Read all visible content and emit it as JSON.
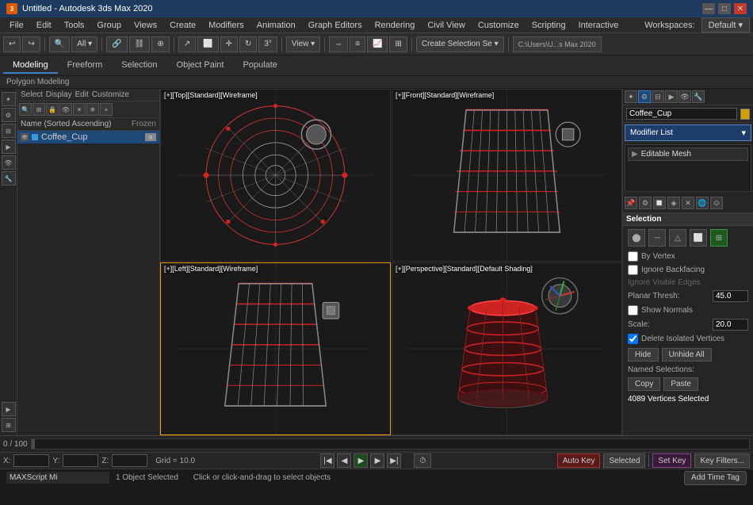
{
  "titlebar": {
    "title": "Untitled - Autodesk 3ds Max 2020",
    "icon": "3",
    "minimize": "—",
    "maximize": "□",
    "close": "✕"
  },
  "menubar": {
    "items": [
      "File",
      "Edit",
      "Tools",
      "Group",
      "Views",
      "Create",
      "Modifiers",
      "Animation",
      "Graph Editors",
      "Rendering",
      "Civil View",
      "Customize",
      "Scripting",
      "Interactive"
    ]
  },
  "toolbar": {
    "undo": "↩",
    "redo": "↪",
    "select_label": "All",
    "workspaces_label": "Workspaces:",
    "workspaces_value": "Default",
    "file_path": "C:\\Users\\U...s Max 2020"
  },
  "ribbon": {
    "tabs": [
      "Modeling",
      "Freeform",
      "Selection",
      "Object Paint",
      "Populate"
    ],
    "active": "Modeling",
    "sub_label": "Polygon Modeling"
  },
  "scene": {
    "header_items": [
      "Select",
      "Display",
      "Edit",
      "Customize"
    ],
    "sort_label": "Name (Sorted Ascending)",
    "frozen_label": "Frozen",
    "object_name": "Coffee_Cup",
    "object_color": "#e07000"
  },
  "viewports": [
    {
      "label": "[+][Top][Standard][Wireframe]",
      "type": "top",
      "active": false
    },
    {
      "label": "[+][Front][Standard][Wireframe]",
      "type": "front",
      "active": false
    },
    {
      "label": "[+][Left][Standard][Wireframe]",
      "type": "left",
      "active": true
    },
    {
      "label": "[+][Perspective][Standard][Default Shading]",
      "type": "perspective",
      "active": false
    }
  ],
  "right_panel": {
    "object_name": "Coffee_Cup",
    "modifier_list_label": "Modifier List",
    "modifier_items": [
      "Editable Mesh"
    ],
    "selection_section": "Selection",
    "by_vertex_label": "By Vertex",
    "ignore_backfacing_label": "Ignore Backfacing",
    "ignore_visible_label": "Ignore Visible Edges",
    "planar_thresh_label": "Planar Thresh:",
    "planar_thresh_value": "45.0",
    "show_normals_label": "Show Normals",
    "scale_label": "Scale:",
    "scale_value": "20.0",
    "delete_isolated_label": "Delete Isolated Vertices",
    "hide_btn": "Hide",
    "unhide_btn": "Unhide All",
    "named_selections_label": "Named Selections:",
    "copy_btn": "Copy",
    "paste_btn": "Paste",
    "vertices_selected": "4089 Vertices Selected"
  },
  "bottom": {
    "frame_range": "0 / 100",
    "x_label": "X:",
    "y_label": "Y:",
    "z_label": "Z:",
    "x_val": "",
    "y_val": "",
    "z_val": "",
    "grid_label": "Grid = 10.0",
    "auto_key_btn": "Auto Key",
    "selected_btn": "Selected",
    "set_key_btn": "Set Key",
    "key_filters_btn": "Key Filters..."
  },
  "statusbar": {
    "script_label": "MAXScript Mi",
    "status_text": "1 Object Selected",
    "hint_text": "Click or click-and-drag to select objects",
    "add_time_tag": "Add Time Tag"
  }
}
